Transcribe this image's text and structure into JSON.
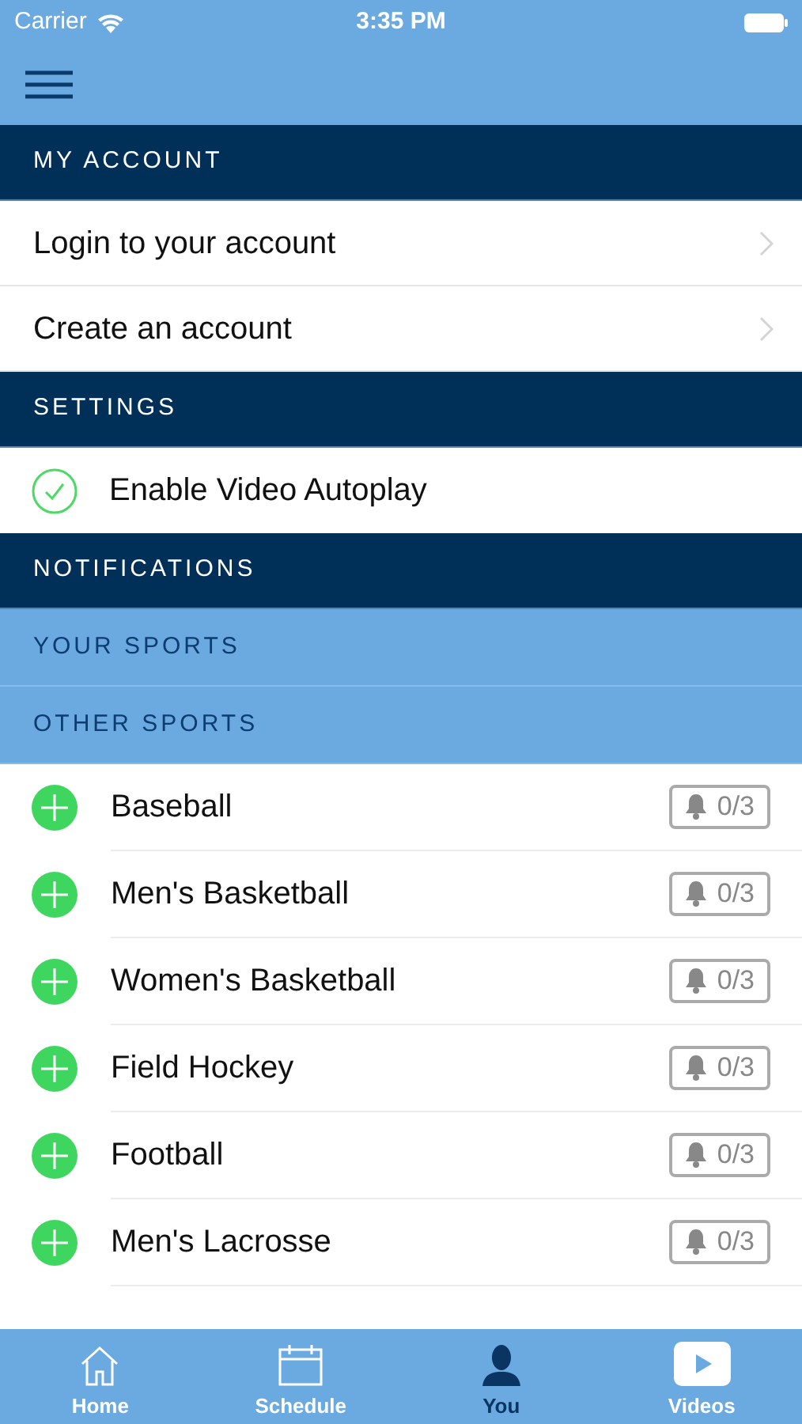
{
  "status_bar": {
    "carrier": "Carrier",
    "time": "3:35 PM"
  },
  "sections": [
    {
      "title": "MY ACCOUNT",
      "kind": "dark",
      "items": [
        {
          "kind": "link",
          "label": "Login to your account"
        },
        {
          "kind": "link",
          "label": "Create an account"
        }
      ]
    },
    {
      "title": "SETTINGS",
      "kind": "dark",
      "items": [
        {
          "kind": "check",
          "label": "Enable Video Autoplay",
          "checked": true
        }
      ]
    },
    {
      "title": "NOTIFICATIONS",
      "kind": "dark"
    },
    {
      "title": "YOUR SPORTS",
      "kind": "light"
    },
    {
      "title": "OTHER SPORTS",
      "kind": "light",
      "items": [
        {
          "kind": "sport",
          "label": "Baseball",
          "count": "0/3"
        },
        {
          "kind": "sport",
          "label": "Men's Basketball",
          "count": "0/3"
        },
        {
          "kind": "sport",
          "label": "Women's Basketball",
          "count": "0/3"
        },
        {
          "kind": "sport",
          "label": "Field Hockey",
          "count": "0/3"
        },
        {
          "kind": "sport",
          "label": "Football",
          "count": "0/3"
        },
        {
          "kind": "sport",
          "label": "Men's Lacrosse",
          "count": "0/3"
        }
      ]
    }
  ],
  "tabs": [
    {
      "label": "Home",
      "selected": false
    },
    {
      "label": "Schedule",
      "selected": false
    },
    {
      "label": "You",
      "selected": true
    },
    {
      "label": "Videos",
      "selected": false
    }
  ]
}
